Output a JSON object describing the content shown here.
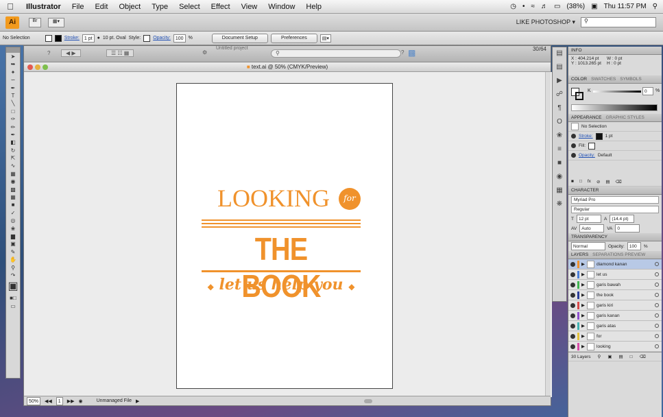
{
  "menubar": {
    "app_name": "Illustrator",
    "menus": [
      "File",
      "Edit",
      "Object",
      "Type",
      "Select",
      "Effect",
      "View",
      "Window",
      "Help"
    ],
    "battery": "(38%)",
    "clock": "Thu 11:57 PM"
  },
  "appbar": {
    "logo": "Ai",
    "workspace": "LIKE PHOTOSHOP",
    "search_placeholder": ""
  },
  "controlbar": {
    "selection_label": "No Selection",
    "stroke_label": "Stroke:",
    "stroke_value": "1 pt",
    "brush_label": "10 pt. Oval",
    "style_label": "Style:",
    "opacity_label": "Opacity:",
    "opacity_value": "100",
    "opacity_unit": "%",
    "document_setup": "Document Setup",
    "preferences": "Preferences"
  },
  "document": {
    "title": "text.ai @ 50% (CMYK/Preview)",
    "breadcrumb": "Untitled project",
    "zoom": "50%",
    "page": "1",
    "status_text": "Unmanaged File",
    "doc_counter": "30/64"
  },
  "artwork": {
    "line1": "LOOKING",
    "for": "for",
    "line2": "THE BOOK",
    "line3": "let us help you",
    "bullet": "◆",
    "color": "#f0922c"
  },
  "panels": {
    "info": {
      "tab": "INFO",
      "x": "X : 404.214 pt",
      "y": "Y : 1013.265 pt",
      "w": "W : 0 pt",
      "h": "H : 0 pt"
    },
    "color": {
      "tabs": [
        "COLOR",
        "SWATCHES",
        "SYMBOLS"
      ],
      "k_label": "K",
      "k_value": "0",
      "k_unit": "%"
    },
    "appearance": {
      "tabs": [
        "APPEARANCE",
        "GRAPHIC STYLES"
      ],
      "selection": "No Selection",
      "stroke_label": "Stroke:",
      "stroke_value": "1 pt",
      "fill_label": "Fill:",
      "opacity_label": "Opacity:",
      "opacity_value": "Default"
    },
    "character": {
      "tab": "CHARACTER",
      "font_family": "Myriad Pro",
      "font_style": "Regular",
      "size": "12 pt",
      "leading": "(14.4 pt)",
      "kerning": "Auto",
      "tracking": "0"
    },
    "transparency": {
      "tab": "TRANSPARENCY",
      "mode": "Normal",
      "opacity_label": "Opacity:",
      "opacity_value": "100",
      "opacity_unit": "%"
    },
    "layers": {
      "tabs": [
        "LAYERS",
        "SEPARATIONS PREVIEW"
      ],
      "items": [
        {
          "name": "diamond kanan",
          "color": "#f0922c",
          "selected": true
        },
        {
          "name": "let us",
          "color": "#4a7fd9",
          "selected": false
        },
        {
          "name": "garis bawah",
          "color": "#3fb34f",
          "selected": false
        },
        {
          "name": "the book",
          "color": "#2c3e9a",
          "selected": false
        },
        {
          "name": "garis kiri",
          "color": "#d94a4a",
          "selected": false
        },
        {
          "name": "garis kanan",
          "color": "#8e4fd0",
          "selected": false
        },
        {
          "name": "garis atas",
          "color": "#3fb3b3",
          "selected": false
        },
        {
          "name": "for",
          "color": "#e3c13a",
          "selected": false
        },
        {
          "name": "looking",
          "color": "#d94aa8",
          "selected": false
        }
      ],
      "count": "30 Layers"
    }
  }
}
